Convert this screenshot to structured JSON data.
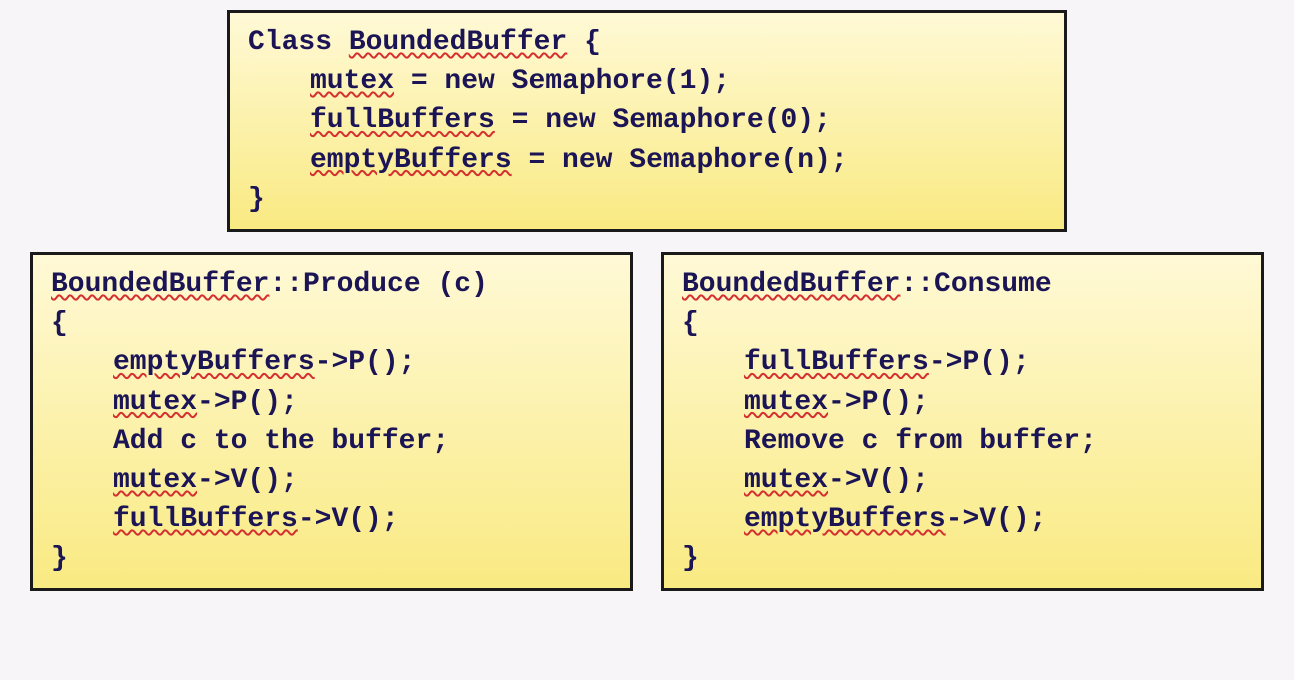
{
  "class_box": {
    "line1_a": "Class ",
    "line1_b": "BoundedBuffer",
    "line1_c": " {",
    "line2_a": "mutex",
    "line2_b": " = new Semaphore(1);",
    "line3_a": "fullBuffers",
    "line3_b": " = new Semaphore(0);",
    "line4_a": "emptyBuffers",
    "line4_b": " = new Semaphore(n);",
    "line5": "}"
  },
  "produce_box": {
    "line1_a": "BoundedBuffer",
    "line1_b": "::Produce (c)",
    "line2": "{",
    "line3_a": "emptyBuffers",
    "line3_b": "->P();",
    "line4_a": "mutex",
    "line4_b": "->P();",
    "line5": "Add c to the buffer;",
    "line6_a": "mutex",
    "line6_b": "->V();",
    "line7_a": "fullBuffers",
    "line7_b": "->V();",
    "line8": "}"
  },
  "consume_box": {
    "line1_a": "BoundedBuffer",
    "line1_b": "::Consume",
    "line2": "{",
    "line3_a": "fullBuffers",
    "line3_b": "->P();",
    "line4_a": "mutex",
    "line4_b": "->P();",
    "line5": "Remove c from buffer;",
    "line6_a": "mutex",
    "line6_b": "->V();",
    "line7_a": "emptyBuffers",
    "line7_b": "->V();",
    "line8": "}"
  }
}
